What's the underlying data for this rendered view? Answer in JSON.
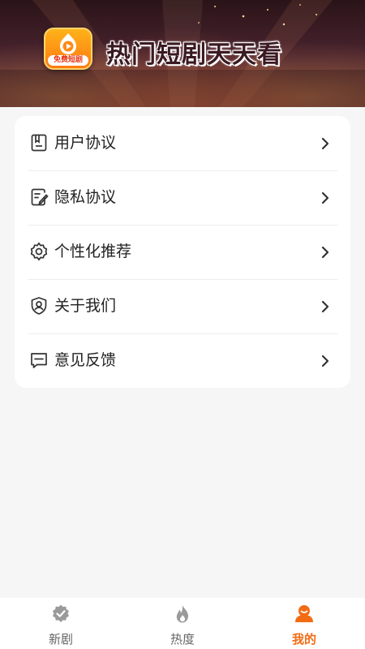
{
  "banner": {
    "logo_tag": "免费短剧",
    "title": "热门短剧天天看"
  },
  "menu": {
    "items": [
      {
        "label": "用户协议",
        "icon": "document-icon"
      },
      {
        "label": "隐私协议",
        "icon": "edit-document-icon"
      },
      {
        "label": "个性化推荐",
        "icon": "gear-icon"
      },
      {
        "label": "关于我们",
        "icon": "shield-user-icon"
      },
      {
        "label": "意见反馈",
        "icon": "message-icon"
      }
    ]
  },
  "tabbar": {
    "tabs": [
      {
        "label": "新剧",
        "icon": "badge-check-icon",
        "active": false
      },
      {
        "label": "热度",
        "icon": "flame-icon",
        "active": false
      },
      {
        "label": "我的",
        "icon": "profile-icon",
        "active": true
      }
    ]
  },
  "colors": {
    "accent": "#f36b13",
    "inactive": "#aaaaaa",
    "text": "#222222"
  }
}
